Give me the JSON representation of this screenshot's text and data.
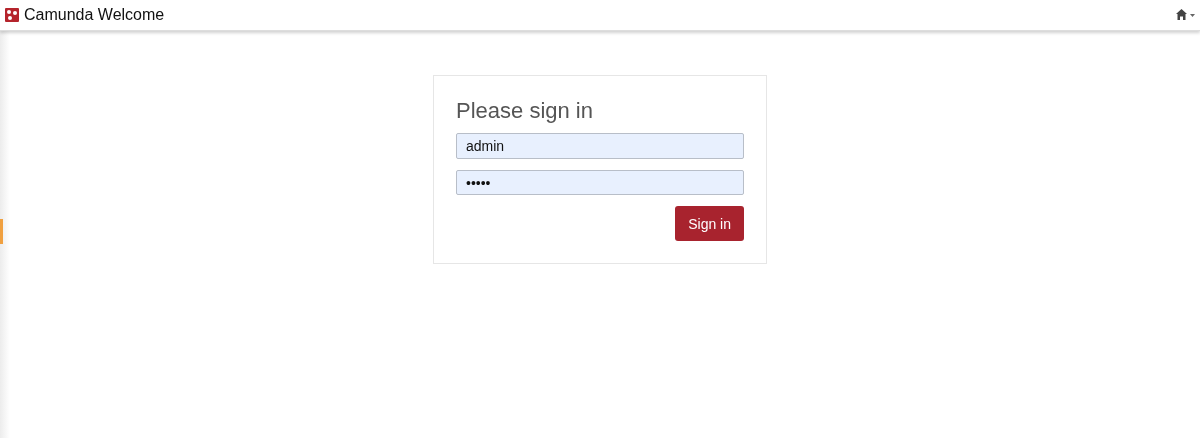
{
  "header": {
    "title": "Camunda Welcome"
  },
  "login": {
    "title": "Please sign in",
    "username": {
      "value": "admin"
    },
    "password": {
      "value": "•••••"
    },
    "submit": "Sign in"
  }
}
